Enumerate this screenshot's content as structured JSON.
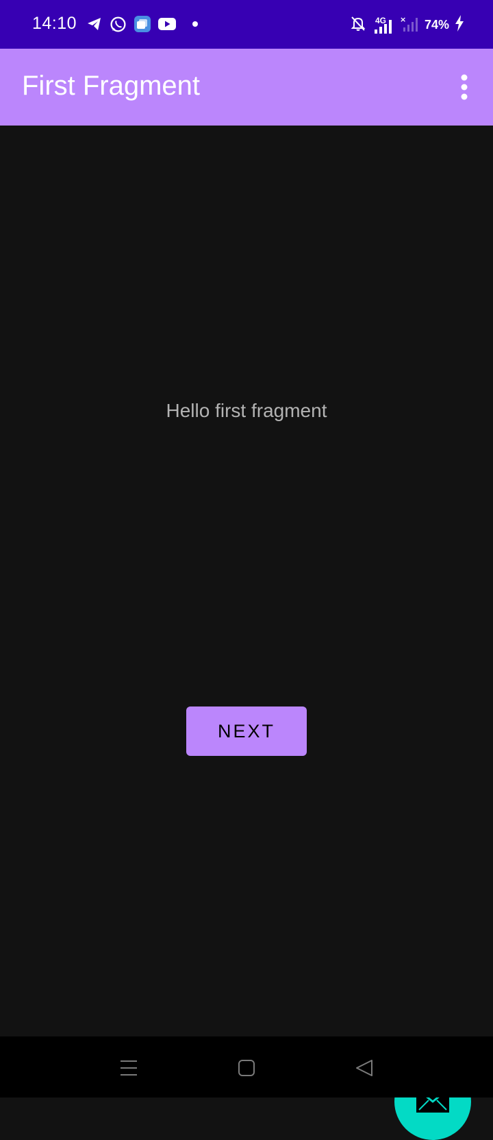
{
  "status_bar": {
    "time": "14:10",
    "battery": "74%",
    "network": "4G",
    "background_color": "#3700b3",
    "left_icons": [
      "telegram-icon",
      "whatsapp-icon",
      "app-notification-icon",
      "youtube-icon",
      "dot-icon"
    ],
    "right_icons": [
      "bell-off-icon",
      "signal-4g-icon",
      "signal-no-service-icon",
      "charging-icon"
    ]
  },
  "app_bar": {
    "title": "First Fragment",
    "background_color": "#bb86fc",
    "menu_icon": "more-vert-icon"
  },
  "main": {
    "message": "Hello first fragment",
    "next_button_label": "NEXT",
    "fab_icon": "mail-icon",
    "fab_color": "#03dac5"
  },
  "nav_bar": {
    "icons": [
      "menu-icon",
      "home-icon",
      "back-icon"
    ]
  }
}
